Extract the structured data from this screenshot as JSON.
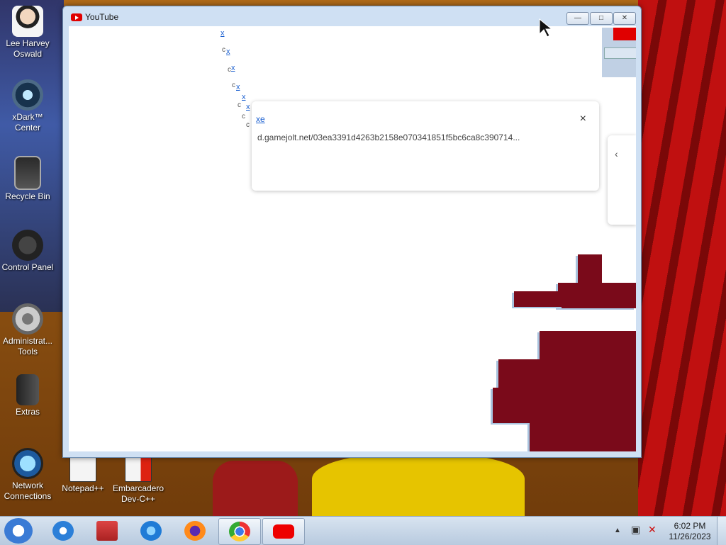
{
  "desktop": {
    "icons": [
      {
        "label": "Lee Harvey Oswald"
      },
      {
        "label": "xDark™ Center"
      },
      {
        "label": "Recycle Bin"
      },
      {
        "label": "Control Panel"
      },
      {
        "label": "Administrat... Tools"
      },
      {
        "label": "Extras"
      },
      {
        "label": "Network Connections"
      },
      {
        "label": "Notepad++"
      },
      {
        "label": "Embarcadero Dev-C++"
      }
    ]
  },
  "window": {
    "title": "YouTube",
    "minimize": "—",
    "maximize": "□",
    "close": "✕"
  },
  "content": {
    "glitch_links": [
      "x",
      "x",
      "x",
      "x",
      "x",
      "x",
      "x"
    ],
    "glitch_letters": [
      "c",
      "c",
      "c",
      "c",
      "c",
      "c",
      "c"
    ],
    "popup": {
      "link": "xe",
      "url": "d.gamejolt.net/03ea3391d4263b2158e070341851f5bc6ca8c390714...",
      "close": "×"
    },
    "side_popup_chevron": "‹"
  },
  "taskbar": {
    "items": [
      "internet-explorer",
      "file-manager",
      "itunes",
      "firefox",
      "chrome",
      "youtube"
    ],
    "time": "6:02 PM",
    "date": "11/26/2023"
  }
}
